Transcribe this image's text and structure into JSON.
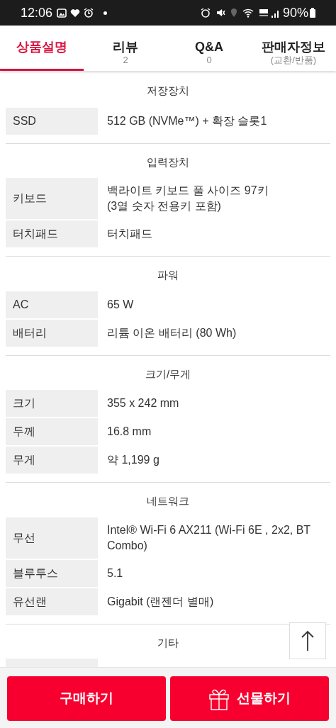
{
  "status_bar": {
    "time": "12:06",
    "battery": "90%"
  },
  "tabs": [
    {
      "label": "상품설명",
      "selected": true
    },
    {
      "label": "리뷰",
      "sub": "2",
      "selected": false
    },
    {
      "label": "Q&A",
      "sub": "0",
      "selected": false
    },
    {
      "label": "판매자정보",
      "sub": "(교환/반품)",
      "selected": false
    }
  ],
  "sections": [
    {
      "title": "저장장치",
      "rows": [
        {
          "label": "SSD",
          "value": "512 GB (NVMe™) + 확장 슬롯1"
        }
      ]
    },
    {
      "title": "입력장치",
      "rows": [
        {
          "label": "키보드",
          "value": "백라이트 키보드 풀 사이즈 97키\n(3열 숫자 전용키 포함)"
        },
        {
          "label": "터치패드",
          "value": "터치패드"
        }
      ]
    },
    {
      "title": "파워",
      "rows": [
        {
          "label": "AC",
          "value": "65 W"
        },
        {
          "label": "배터리",
          "value": "리튬 이온 배터리 (80 Wh)"
        }
      ]
    },
    {
      "title": "크기/무게",
      "rows": [
        {
          "label": "크기",
          "value": "355 x 242 mm"
        },
        {
          "label": "두께",
          "value": "16.8 mm"
        },
        {
          "label": "무게",
          "value": "약 1,199 g"
        }
      ]
    },
    {
      "title": "네트워크",
      "rows": [
        {
          "label": "무선",
          "value": "Intel® Wi-Fi 6 AX211 (Wi-Fi 6E , 2x2, BT Combo)"
        },
        {
          "label": "블루투스",
          "value": "5.1"
        },
        {
          "label": "유선랜",
          "value": "Gigabit (랜젠더 별매)"
        }
      ]
    },
    {
      "title": "기타"
    }
  ],
  "buttons": [
    {
      "label": "구매하기",
      "kind": "buy"
    },
    {
      "label": "선물하기",
      "kind": "gift"
    }
  ]
}
